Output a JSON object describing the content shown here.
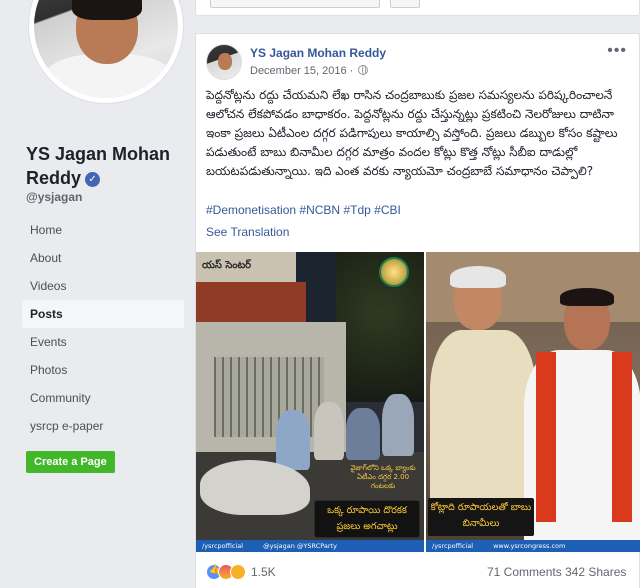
{
  "profile": {
    "name": "YS Jagan Mohan Reddy",
    "handle": "@ysjagan"
  },
  "nav": {
    "items": [
      {
        "label": "Home"
      },
      {
        "label": "About"
      },
      {
        "label": "Videos"
      },
      {
        "label": "Posts",
        "active": true
      },
      {
        "label": "Events"
      },
      {
        "label": "Photos"
      },
      {
        "label": "Community"
      },
      {
        "label": "ysrcp e-paper"
      }
    ],
    "create_page_label": "Create a Page"
  },
  "post": {
    "author": "YS Jagan Mohan Reddy",
    "date": "December 15, 2016",
    "text": "పెద్దనోట్లను రద్దు చేయమని లేఖ రాసిన చంద్రబాబుకు ప్రజల సమస్యలను పరిష్కరించాలనే ఆలోచన లేకపోవడం బాధాకరం. పెద్దనోట్లను రద్దు చేస్తున్నట్లు ప్రకటించి నెలరోజులు దాటినా ఇంకా ప్రజలు ఏటీఎంల దగ్గర పడిగాపులు కాయాల్సి వస్తోంది. ప్రజలు డబ్బుల కోసం కష్టాలు పడుతుంటే బాబు బినామీల దగ్గర మాత్రం వందల కోట్లు కొత్త నోట్లు సీబీఐ దాడుల్లో బయటపడుతున్నాయి. ఇది ఎంత వరకు న్యాయమో చంద్రబాబే సమాధానం చెప్పాలి?",
    "hashtags": [
      "#Demonetisation",
      "#NCBN",
      "#Tdp",
      "#CBI"
    ],
    "see_translation": "See Translation",
    "images": {
      "left": {
        "banner_text": "యస్ సెంటర్",
        "stamp_text": "వైజాగ్‌లోని ఒక్క బ్యాంకు ఏటీఎం దగ్గర 2.00 గంటలకు",
        "caption": "ఒక్క రూపాయి దొరకక ప్రజలు అగచాట్లు",
        "footer": [
          "/ysrcpofficial",
          "@ysjagan  @YSRCParty"
        ]
      },
      "right": {
        "caption": "కోట్లాది రూపాయలతో బాబు బినామీలు",
        "footer": [
          "/ysrcpofficial",
          "www.ysrcongress.com"
        ]
      }
    },
    "reaction_count": "1.5K",
    "comments": "71 Comments",
    "shares": "342 Shares"
  },
  "colors": {
    "link": "#365899",
    "create_button": "#42b72a",
    "verified": "#4267b2",
    "background": "#e9ebee"
  },
  "icons": [
    "verified-badge-icon",
    "globe-icon",
    "more-options-icon",
    "like-reaction-icon",
    "angry-reaction-icon",
    "sad-reaction-icon"
  ]
}
